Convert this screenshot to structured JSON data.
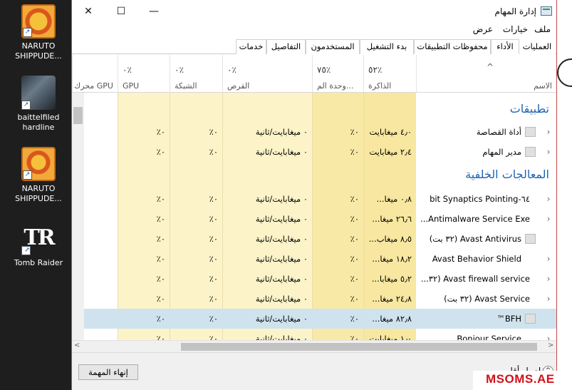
{
  "desktop": {
    "icons": [
      {
        "label_1": "NARUTO",
        "label_2": "SHIPPUDE...",
        "icon": "naruto-game-icon"
      },
      {
        "label_1": "baittelfiled",
        "label_2": "hardline",
        "icon": "battlefield-game-icon"
      },
      {
        "label_1": "NARUTO",
        "label_2": "SHIPPUDE...",
        "icon": "naruto-game-icon"
      },
      {
        "label_1": "Tomb Raider",
        "label_2": "",
        "icon": "tomb-raider-game-icon",
        "glyph": "TR"
      }
    ],
    "shortcut_glyph": "↗"
  },
  "window": {
    "title": "إدارة المهام",
    "controls": {
      "close": "✕",
      "maximize": "☐",
      "minimize": "—"
    },
    "menu": [
      "ملف",
      "خيارات",
      "عرض"
    ],
    "tabs": [
      "العمليات",
      "الأداء",
      "محفوظات التطبيقات",
      "بدء التشغيل",
      "المستخدمون",
      "التفاصيل",
      "خدمات"
    ],
    "active_tab": "العمليات"
  },
  "columns": {
    "name": {
      "label": "الاسم",
      "sort_glyph": "^"
    },
    "memory": {
      "pct": "٥٢٪",
      "label": "الذاكرة"
    },
    "cpu": {
      "pct": "٧٥٪",
      "label": "وحدة الم..."
    },
    "disk": {
      "pct": "٠٪",
      "label": "القرص"
    },
    "network": {
      "pct": "٠٪",
      "label": "الشبكة"
    },
    "gpu": {
      "pct": "٠٪",
      "label": "GPU"
    },
    "gpu_engine": {
      "label": "محرك GPU"
    }
  },
  "sections": {
    "apps": "تطبيقات",
    "background": "المعالجات الخلفية"
  },
  "apps": [
    {
      "name": "أداة القصاصة",
      "memory": "٤٫٠ ميغابايت",
      "cpu": "٠٪",
      "disk": "٠ ميغابايت/ثانية",
      "network": "٠٪",
      "gpu": "٠٪"
    },
    {
      "name": "مدير المهام",
      "memory": "٢٫٤ ميغابايت",
      "cpu": "٠٪",
      "disk": "٠ ميغابايت/ثانية",
      "network": "٠٪",
      "gpu": "٠٪"
    }
  ],
  "background": [
    {
      "name": "٦٤-bit Synaptics Pointing",
      "memory": "٠٫٨ ميغا...",
      "cpu": "٠٪",
      "disk": "٠ ميغابايت/ثانية",
      "network": "٠٪",
      "gpu": "٠٪"
    },
    {
      "name": "Antimalware Service Exe...",
      "memory": "٢٦٫٦ ميغا...",
      "cpu": "٠٪",
      "disk": "٠ ميغابايت/ثانية",
      "network": "٠٪",
      "gpu": "٠٪"
    },
    {
      "name": "Avast Antivirus (٣٢ بت)",
      "memory": "٨٫٥ ميغاب...",
      "cpu": "٠٪",
      "disk": "٠ ميغابايت/ثانية",
      "network": "٠٪",
      "gpu": "٠٪"
    },
    {
      "name": "Avast Behavior Shield",
      "memory": "١٨٫٢ ميغا...",
      "cpu": "٠٪",
      "disk": "٠ ميغابايت/ثانية",
      "network": "٠٪",
      "gpu": "٠٪"
    },
    {
      "name": "Avast firewall service (٣٢...",
      "memory": "٥٫٢ ميغابا...",
      "cpu": "٠٪",
      "disk": "٠ ميغابايت/ثانية",
      "network": "٠٪",
      "gpu": "٠٪"
    },
    {
      "name": "Avast Service (٣٢ بت)",
      "memory": "٢٤٫٨ ميغا...",
      "cpu": "٠٪",
      "disk": "٠ ميغابايت/ثانية",
      "network": "٠٪",
      "gpu": "٠٪"
    },
    {
      "name": "BFH™",
      "memory": "٨٢٫٨ ميغا...",
      "cpu": "٠٪",
      "disk": "٠ ميغابايت/ثانية",
      "network": "٠٪",
      "gpu": "٠٪",
      "selected": true
    },
    {
      "name": "Bonjour Service",
      "memory": "١٫٠ ميغابايت",
      "cpu": "٠٪",
      "disk": "٠ ميغابايت/ثانية",
      "network": "٠٪",
      "gpu": "٠٪"
    }
  ],
  "footer": {
    "end_task": "إنهاء المهمة",
    "fewer_details": "تفاصيل أقل",
    "fewer_icon": "^"
  },
  "watermark": "MSOMS.AE",
  "scroll": {
    "left_arrow": "<",
    "right_arrow": ">"
  }
}
